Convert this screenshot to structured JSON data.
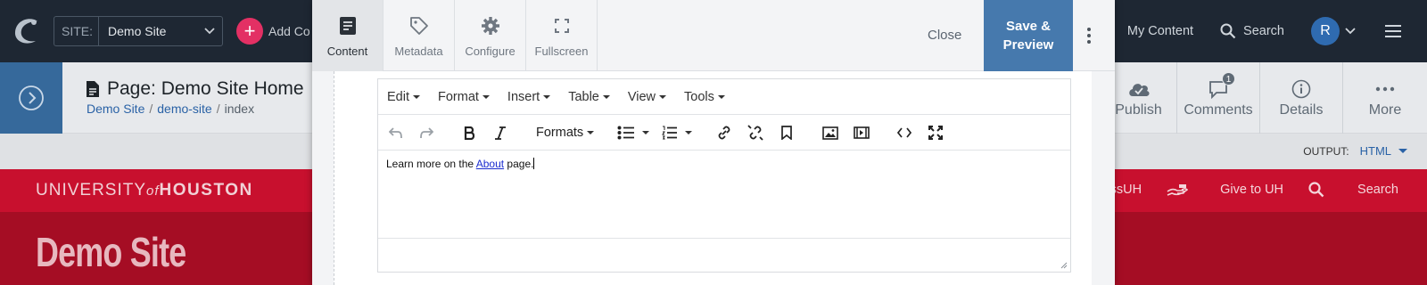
{
  "topbar": {
    "site_prefix": "SITE:",
    "site_value": "Demo Site",
    "add_label": "Add Co",
    "my_content": "My Content",
    "search": "Search",
    "avatar_initial": "R"
  },
  "pagebar": {
    "title": "Page: Demo Site Home",
    "breadcrumb": [
      "Demo Site",
      "demo-site",
      "index"
    ],
    "actions": [
      {
        "label": "Publish",
        "icon": "cloud-upload-icon"
      },
      {
        "label": "Comments",
        "icon": "comment-icon",
        "badge": "1"
      },
      {
        "label": "Details",
        "icon": "info-icon"
      },
      {
        "label": "More",
        "icon": "dots-icon"
      }
    ]
  },
  "outputbar": {
    "label": "OUTPUT:",
    "value": "HTML"
  },
  "uh": {
    "logo_part1": "UNIVERSITY",
    "logo_part2": "of",
    "logo_part3": "HOUSTON",
    "links": [
      "to AccessUH",
      "Give to UH",
      "Search"
    ],
    "hero_title": "Demo Site"
  },
  "modal": {
    "tabs": [
      {
        "label": "Content",
        "icon": "document-icon",
        "active": true
      },
      {
        "label": "Metadata",
        "icon": "tag-icon"
      },
      {
        "label": "Configure",
        "icon": "gear-icon"
      },
      {
        "label": "Fullscreen",
        "icon": "expand-icon"
      }
    ],
    "close": "Close",
    "save_line1": "Save &",
    "save_line2": "Preview"
  },
  "editor": {
    "menus": [
      "Edit",
      "Format",
      "Insert",
      "Table",
      "View",
      "Tools"
    ],
    "formats_label": "Formats",
    "content_before": "Learn more on the ",
    "content_link": "About",
    "content_after": " page."
  },
  "colors": {
    "topbar_bg": "#1e2733",
    "accent_blue": "#4679ad",
    "uh_red": "#c8102e",
    "uh_dark_red": "#a50d24",
    "add_pink": "#e33064"
  }
}
